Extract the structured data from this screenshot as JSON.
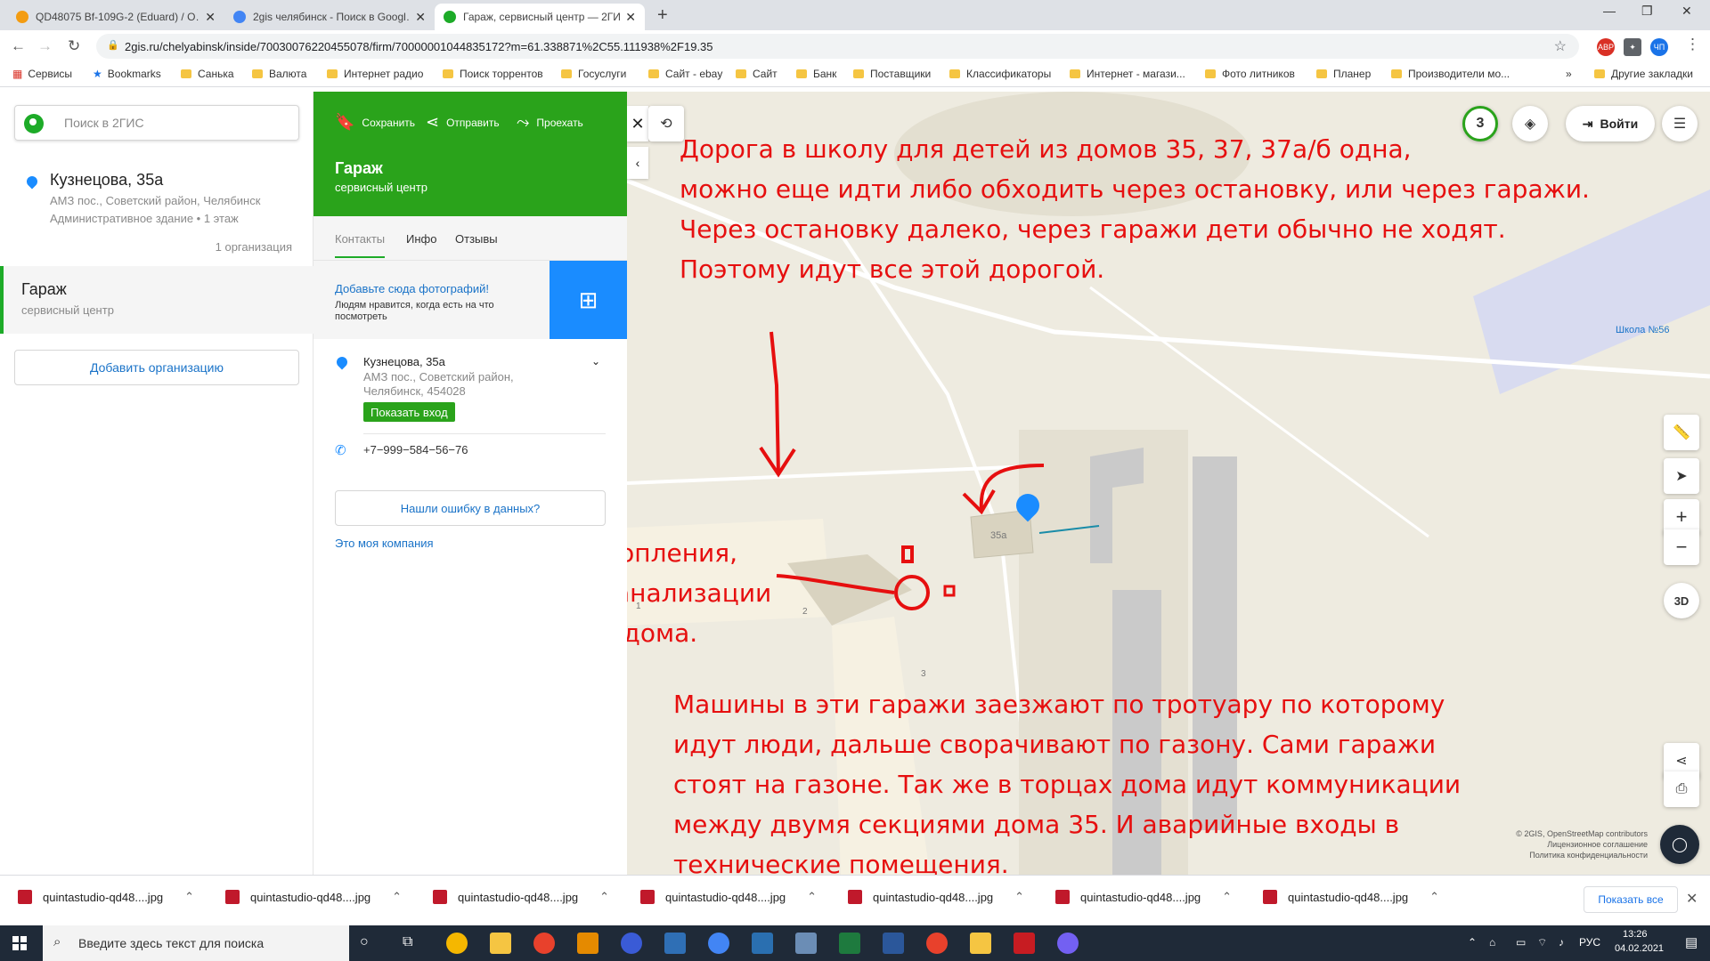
{
  "browser": {
    "tabs": [
      {
        "title": "QD48075 Bf-109G-2 (Eduard) / O…",
        "color": "#f39c12"
      },
      {
        "title": "2gis челябинск - Поиск в Googl…",
        "color": "#4285f4"
      },
      {
        "title": "Гараж, сервисный центр — 2ГИ…",
        "color": "#1dab28"
      }
    ],
    "url": "2gis.ru/chelyabinsk/inside/70030076220455078/firm/70000001044835172?m=61.338871%2C55.111938%2F19.35",
    "extensions": [
      "ABP",
      "ЧП"
    ],
    "bookmarks": [
      "Сервисы",
      "Bookmarks",
      "Санька",
      "Валюта",
      "Интернет радио",
      "Поиск торрентов",
      "Госуслуги",
      "Сайт - ebay",
      "Сайт",
      "Банк",
      "Поставщики",
      "Классификаторы",
      "Интернет - магази...",
      "Фото литников",
      "Планер",
      "Производители мо..."
    ],
    "other_bookmarks": "Другие закладки"
  },
  "left": {
    "search_placeholder": "Поиск в 2ГИС",
    "result1": {
      "title": "Кузнецова, 35а",
      "line1": "АМЗ пос., Советский район, Челябинск",
      "line2": "Административное здание • 1 этаж",
      "count": "1 организация"
    },
    "result2": {
      "title": "Гараж",
      "sub": "сервисный центр"
    },
    "add_org": "Добавить организацию"
  },
  "card": {
    "actions": [
      "Сохранить",
      "Отправить",
      "Проехать"
    ],
    "title": "Гараж",
    "subtitle": "сервисный центр",
    "tabs": [
      "Контакты",
      "Инфо",
      "Отзывы"
    ],
    "photo_title": "Добавьте сюда фотографий!",
    "photo_text": "Людям нравится, когда есть на что посмотреть",
    "address": "Кузнецова, 35а",
    "address2": "АМЗ пос., Советский район, Челябинск, 454028",
    "show_entrance": "Показать вход",
    "phone": "+7−999−584−56−76",
    "error_btn": "Нашли ошибку в данных?",
    "my_company": "Это моя компания"
  },
  "map": {
    "login": "Войти",
    "badge": "3",
    "btn_3d": "3D",
    "school": "Школа №56",
    "building_label": "35а",
    "entrance_labels": [
      "1",
      "2",
      "3"
    ],
    "annotations": {
      "top": [
        "Дорога в школу для детей из домов 35, 37, 37а/б одна,",
        "можно еще идти либо обходить через остановку, или через гаражи.",
        "Через остановку далеко, через гаражи дети обычно не ходят.",
        "Поэтому идут все этой дорогой."
      ],
      "middle": [
        "Трубы отопления,",
        "воды и канализации",
        "снаружи дома."
      ],
      "bottom": [
        "Машины в эти гаражи заезжают по тротуару по которому",
        "идут люди, дальше сворачивают по газону. Сами гаражи",
        "стоят на газоне. Так же в торцах дома идут коммуникации",
        "между двумя секциями дома 35. И аварийные входы в",
        "технические помещения."
      ]
    },
    "copyright": [
      "© 2GIS, OpenStreetMap contributors",
      "Лицензионное соглашение",
      "Политика конфиденциальности"
    ]
  },
  "downloads": {
    "file": "quintastudio-qd48....jpg",
    "count": 7,
    "show_all": "Показать все"
  },
  "taskbar": {
    "search": "Введите здесь текст для поиска",
    "lang": "РУС",
    "time": "13:26",
    "date": "04.02.2021"
  }
}
